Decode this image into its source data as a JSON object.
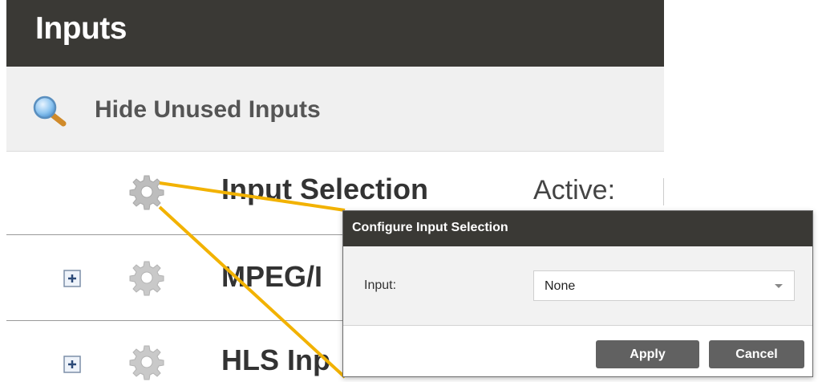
{
  "panel": {
    "title": "Inputs",
    "hide_unused_label": "Hide Unused Inputs",
    "active_label": "Active:"
  },
  "rows": [
    {
      "label": "Input Selection",
      "icon": "gear-icon",
      "expandable": false
    },
    {
      "label": "MPEG/I",
      "icon": "gear-icon",
      "expandable": true
    },
    {
      "label": "HLS Inp",
      "icon": "gear-icon",
      "expandable": true
    }
  ],
  "dialog": {
    "title": "Configure Input Selection",
    "input_label": "Input:",
    "input_value": "None",
    "apply_label": "Apply",
    "cancel_label": "Cancel"
  },
  "colors": {
    "header_bg": "#3a3935",
    "toolbar_bg": "#f0f0f0",
    "button_bg": "#616161",
    "callout_line": "#f2b200"
  }
}
